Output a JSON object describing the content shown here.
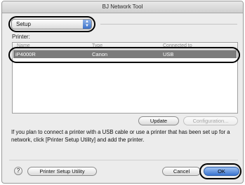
{
  "window": {
    "title": "BJ Network Tool"
  },
  "setup_popup": {
    "value": "Setup",
    "arrows": "▲▼"
  },
  "printer_label": "Printer:",
  "table": {
    "columns": [
      "Name",
      "Type",
      "Connected to"
    ],
    "rows": [
      {
        "name": "iP4000R",
        "type": "Canon",
        "connected": "USB",
        "selected": true
      }
    ]
  },
  "buttons": {
    "update": "Update",
    "configuration": "Configuration...",
    "printer_setup": "Printer Setup Utility",
    "cancel": "Cancel",
    "ok": "OK",
    "help": "?"
  },
  "info_text": "If you plan to connect a printer with a USB cable or use a printer that has been set up for a network, click [Printer Setup Utility] and add the printer.",
  "colors": {
    "selection": "#7b7b7b",
    "default_button": "#3a74d0",
    "highlight_oval": "#000000"
  }
}
